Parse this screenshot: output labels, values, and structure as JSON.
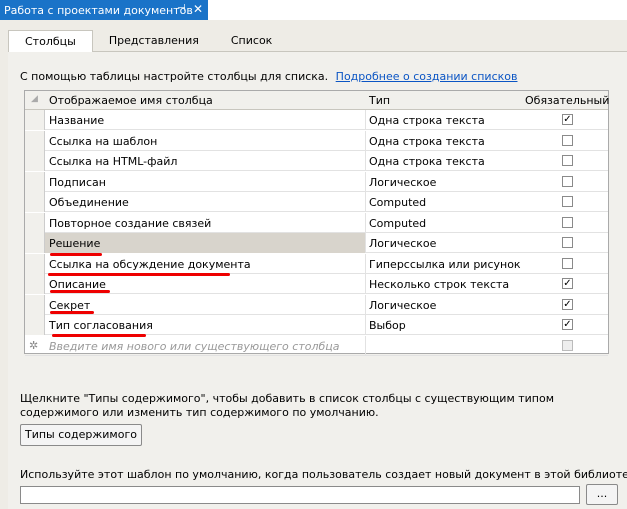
{
  "document_tab": {
    "title": "Работа с проектами документов",
    "pin_glyph": "⊣",
    "close_glyph": "✕"
  },
  "tabs": [
    {
      "label": "Столбцы",
      "active": true
    },
    {
      "label": "Представления",
      "active": false
    },
    {
      "label": "Список",
      "active": false
    }
  ],
  "help": {
    "text": "С помощью таблицы настройте столбцы для списка.",
    "link": "Подробнее о создании списков"
  },
  "grid": {
    "headers": {
      "name": "Отображаемое имя столбца",
      "type": "Тип",
      "required": "Обязательный"
    },
    "rows": [
      {
        "name": "Название",
        "type": "Одна строка текста",
        "required": true
      },
      {
        "name": "Ссылка на шаблон",
        "type": "Одна строка текста",
        "required": false
      },
      {
        "name": "Ссылка на HTML-файл",
        "type": "Одна строка текста",
        "required": false
      },
      {
        "name": "Подписан",
        "type": "Логическое",
        "required": false
      },
      {
        "name": "Объединение",
        "type": "Computed",
        "required": false
      },
      {
        "name": "Повторное создание связей",
        "type": "Computed",
        "required": false
      },
      {
        "name": "Решение",
        "type": "Логическое",
        "required": false
      },
      {
        "name": "Ссылка на обсуждение документа",
        "type": "Гиперссылка или рисунок",
        "required": false
      },
      {
        "name": "Описание",
        "type": "Несколько строк текста",
        "required": true
      },
      {
        "name": "Секрет",
        "type": "Логическое",
        "required": true
      },
      {
        "name": "Тип согласования",
        "type": "Выбор",
        "required": true
      }
    ],
    "new_row_placeholder": "Введите имя нового или существующего столбца"
  },
  "content_types": {
    "note": "Щелкните \"Типы содержимого\", чтобы добавить в список столбцы с существующим типом содержимого или изменить тип содержимого по умолчанию.",
    "button_label": "Типы содержимого"
  },
  "template": {
    "note": "Используйте этот шаблон по умолчанию, когда пользователь создает новый документ в этой библиотеке.",
    "value": "",
    "browse_label": "..."
  },
  "colors": {
    "tab_accent": "#1a73c8",
    "link": "#0b55c4",
    "annotation": "#e00000"
  }
}
